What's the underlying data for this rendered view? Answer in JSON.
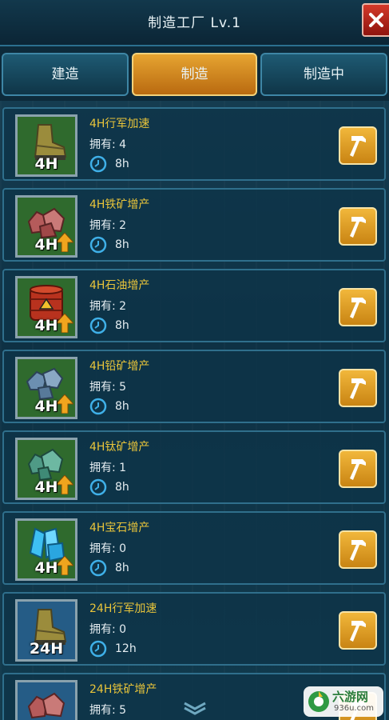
{
  "header": {
    "title": "制造工厂 Lv.1",
    "close_icon": "close-icon"
  },
  "tabs": [
    {
      "label": "建造",
      "active": false
    },
    {
      "label": "制造",
      "active": true
    },
    {
      "label": "制造中",
      "active": false
    }
  ],
  "labels": {
    "owned_prefix": "拥有: "
  },
  "items": [
    {
      "name": "4H行军加速",
      "owned": "拥有: 4",
      "time": "8h",
      "badge": "4H",
      "icon": "boot-icon"
    },
    {
      "name": "4H铁矿增产",
      "owned": "拥有: 2",
      "time": "8h",
      "badge": "4H",
      "icon": "iron-ore-icon"
    },
    {
      "name": "4H石油增产",
      "owned": "拥有: 2",
      "time": "8h",
      "badge": "4H",
      "icon": "oil-barrel-icon"
    },
    {
      "name": "4H铅矿增产",
      "owned": "拥有: 5",
      "time": "8h",
      "badge": "4H",
      "icon": "lead-ore-icon"
    },
    {
      "name": "4H钛矿增产",
      "owned": "拥有: 1",
      "time": "8h",
      "badge": "4H",
      "icon": "titanium-ore-icon"
    },
    {
      "name": "4H宝石增产",
      "owned": "拥有: 0",
      "time": "8h",
      "badge": "4H",
      "icon": "gem-icon"
    },
    {
      "name": "24H行军加速",
      "owned": "拥有: 0",
      "time": "12h",
      "badge": "24H",
      "icon": "boot-icon"
    },
    {
      "name": "24H铁矿增产",
      "owned": "拥有: 5",
      "time": "",
      "badge": "",
      "icon": "iron-ore-icon"
    }
  ],
  "watermark": {
    "name": "六游网",
    "url": "936u.com"
  },
  "colors": {
    "accent_gold": "#e8c43a",
    "tab_active": "#e6a431",
    "panel": "#0e3448",
    "close_red": "#c1281c"
  }
}
